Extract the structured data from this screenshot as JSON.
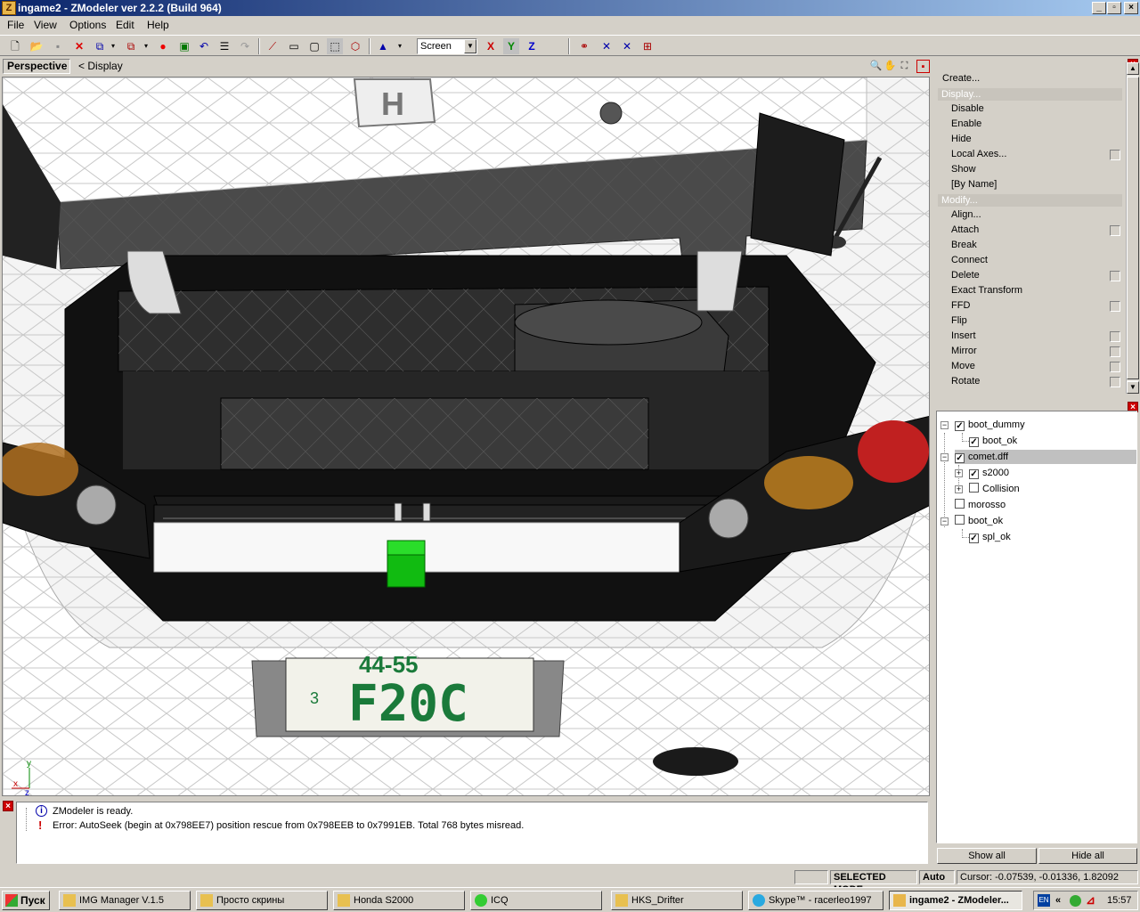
{
  "window": {
    "title": "ingame2 - ZModeler ver 2.2.2 (Build 964)",
    "app_icon": "Z"
  },
  "menu": [
    "File",
    "View",
    "Options",
    "Edit",
    "Help"
  ],
  "toolbar": {
    "coord_select": "Screen",
    "axis_x": "X",
    "axis_y": "Y",
    "axis_z": "Z"
  },
  "viewport": {
    "mode": "Perspective",
    "breadcrumb_sep": "<",
    "breadcrumb": "Display",
    "plate_text": "F20C",
    "plate_top": "44-55",
    "plate_small": "3",
    "axis_labels": {
      "y": "y",
      "x": "x",
      "z": "z"
    }
  },
  "commands": {
    "create": "Create...",
    "display_header": "Display...",
    "display_items": [
      "Disable",
      "Enable",
      "Hide",
      "Local Axes...",
      "Show",
      "[By Name]"
    ],
    "modify_header": "Modify...",
    "modify_items": [
      "Align...",
      "Attach",
      "Break",
      "Connect",
      "Delete",
      "Exact Transform",
      "FFD",
      "Flip",
      "Insert",
      "Mirror",
      "Move",
      "Rotate"
    ]
  },
  "tree": {
    "items": [
      {
        "label": "boot_dummy",
        "checked": true
      },
      {
        "label": "boot_ok",
        "checked": true
      },
      {
        "label": "comet.dff",
        "checked": true
      },
      {
        "label": "s2000",
        "checked": true
      },
      {
        "label": "Collision",
        "checked": false
      },
      {
        "label": "morosso",
        "checked": false
      },
      {
        "label": "boot_ok",
        "checked": false
      },
      {
        "label": "spl_ok",
        "checked": true
      }
    ],
    "show_all": "Show all",
    "hide_all": "Hide all"
  },
  "log": {
    "lines": [
      "ZModeler is ready.",
      "Error: AutoSeek (begin at 0x798EE7) position rescue  from 0x798EEB to 0x7991EB. Total 768 bytes misread."
    ]
  },
  "status": {
    "mode": "SELECTED MODE",
    "auto": "Auto",
    "cursor": "Cursor: -0.07539, -0.01336, 1.82092"
  },
  "taskbar": {
    "start": "Пуск",
    "tasks": [
      "IMG Manager V.1.5",
      "Просто скрины",
      "Honda S2000",
      "ICQ",
      "HKS_Drifter",
      "Skype™ - racerleo1997",
      "ingame2 - ZModeler..."
    ],
    "lang": "EN",
    "time": "15:57"
  }
}
